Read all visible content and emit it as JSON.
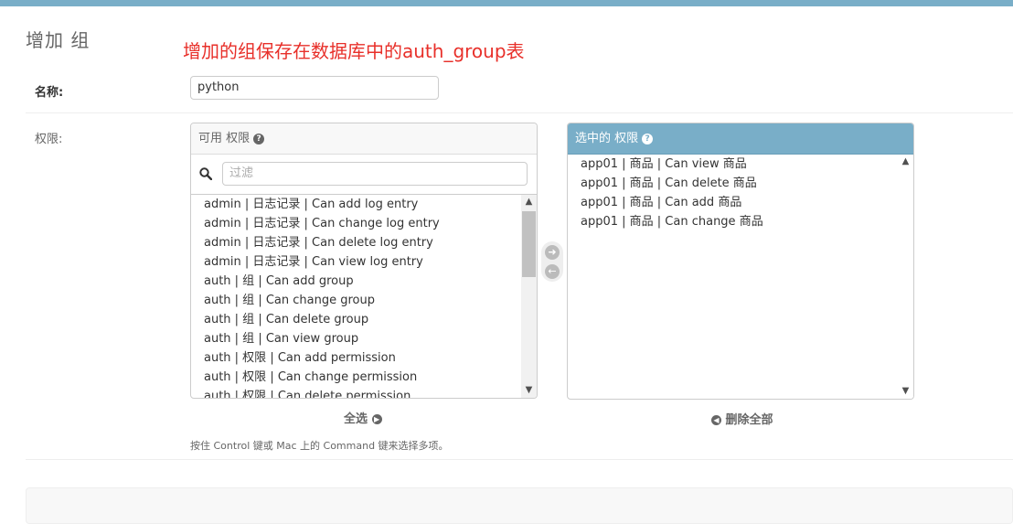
{
  "header": {
    "title": "增加 组"
  },
  "annotation": "增加的组保存在数据库中的auth_group表",
  "name_field": {
    "label": "名称:",
    "value": "python"
  },
  "permissions": {
    "label": "权限:",
    "available": {
      "title": "可用 权限",
      "filter_placeholder": "过滤",
      "items": [
        "admin | 日志记录 | Can add log entry",
        "admin | 日志记录 | Can change log entry",
        "admin | 日志记录 | Can delete log entry",
        "admin | 日志记录 | Can view log entry",
        "auth | 组 | Can add group",
        "auth | 组 | Can change group",
        "auth | 组 | Can delete group",
        "auth | 组 | Can view group",
        "auth | 权限 | Can add permission",
        "auth | 权限 | Can change permission",
        "auth | 权限 | Can delete permission"
      ]
    },
    "chosen": {
      "title": "选中的 权限",
      "items": [
        "app01 | 商品 | Can view 商品",
        "app01 | 商品 | Can delete 商品",
        "app01 | 商品 | Can add 商品",
        "app01 | 商品 | Can change 商品"
      ]
    },
    "select_all_label": "全选",
    "remove_all_label": "删除全部",
    "help_text": "按住 Control 键或 Mac 上的 Command 键来选择多项。"
  }
}
